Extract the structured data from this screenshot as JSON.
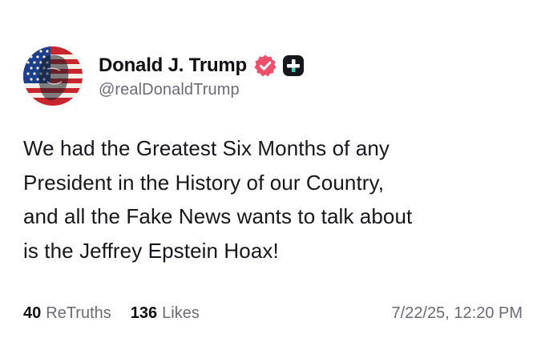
{
  "author": {
    "display_name": "Donald J. Trump",
    "handle": "@realDonaldTrump",
    "avatar_icon": "flag-portrait-avatar",
    "verified_icon": "verified-badge-icon",
    "plus_icon": "truth-plus-icon"
  },
  "post": {
    "lines": [
      "We had the Greatest Six Months of any",
      "President in the History of our Country,",
      "and all the Fake News wants to talk about",
      "is the Jeffrey Epstein Hoax!"
    ]
  },
  "stats": {
    "retruths_count": "40",
    "retruths_label": "ReTruths",
    "likes_count": "136",
    "likes_label": "Likes",
    "timestamp": "7/22/25, 12:20 PM"
  },
  "colors": {
    "verified": "#ee4f6b",
    "plus_badge": "#16161d",
    "text": "#16161d",
    "muted": "#6b6b78"
  }
}
